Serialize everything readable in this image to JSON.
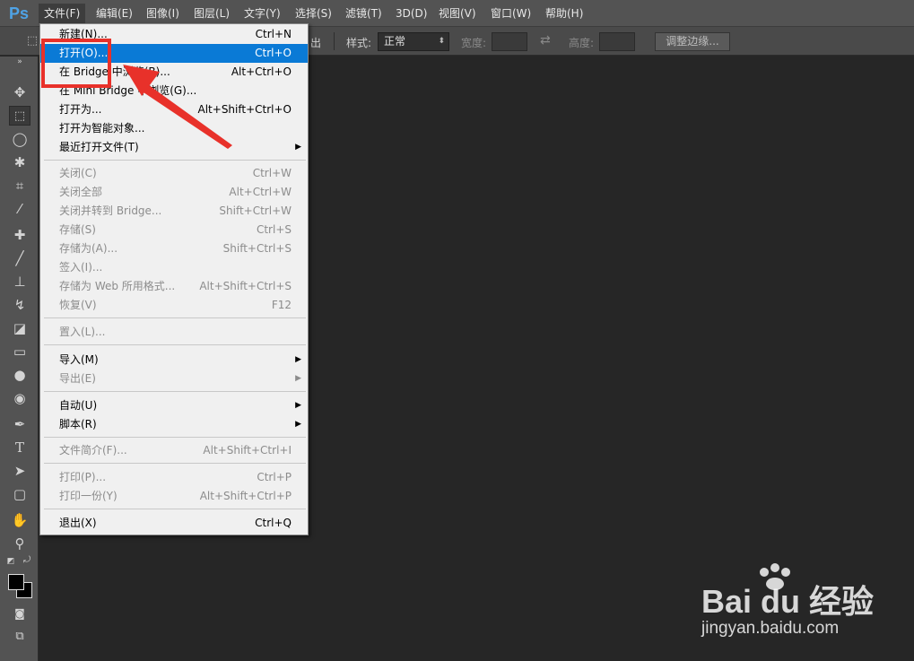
{
  "app": {
    "logo": "Ps"
  },
  "menubar": {
    "items": [
      "文件(F)",
      "编辑(E)",
      "图像(I)",
      "图层(L)",
      "文字(Y)",
      "选择(S)",
      "滤镜(T)",
      "3D(D)",
      "视图(V)",
      "窗口(W)",
      "帮助(H)"
    ]
  },
  "options": {
    "partial_label": "出",
    "style_label": "样式:",
    "style_value": "正常",
    "width_label": "宽度:",
    "height_label": "高度:",
    "refine_button": "调整边缘..."
  },
  "file_menu": {
    "items": [
      {
        "label": "新建(N)...",
        "shortcut": "Ctrl+N",
        "disabled": false
      },
      {
        "label": "打开(O)...",
        "shortcut": "Ctrl+O",
        "disabled": false,
        "highlighted": true
      },
      {
        "label": "在 Bridge 中浏览(B)...",
        "shortcut": "Alt+Ctrl+O",
        "disabled": false
      },
      {
        "label": "在 Mini Bridge 中浏览(G)...",
        "shortcut": "",
        "disabled": false
      },
      {
        "label": "打开为...",
        "shortcut": "Alt+Shift+Ctrl+O",
        "disabled": false
      },
      {
        "label": "打开为智能对象...",
        "shortcut": "",
        "disabled": false
      },
      {
        "label": "最近打开文件(T)",
        "shortcut": "",
        "disabled": false,
        "submenu": true
      },
      {
        "label": "关闭(C)",
        "shortcut": "Ctrl+W",
        "disabled": true
      },
      {
        "label": "关闭全部",
        "shortcut": "Alt+Ctrl+W",
        "disabled": true
      },
      {
        "label": "关闭并转到 Bridge...",
        "shortcut": "Shift+Ctrl+W",
        "disabled": true
      },
      {
        "label": "存储(S)",
        "shortcut": "Ctrl+S",
        "disabled": true
      },
      {
        "label": "存储为(A)...",
        "shortcut": "Shift+Ctrl+S",
        "disabled": true
      },
      {
        "label": "签入(I)...",
        "shortcut": "",
        "disabled": true
      },
      {
        "label": "存储为 Web 所用格式...",
        "shortcut": "Alt+Shift+Ctrl+S",
        "disabled": true
      },
      {
        "label": "恢复(V)",
        "shortcut": "F12",
        "disabled": true
      },
      {
        "label": "置入(L)...",
        "shortcut": "",
        "disabled": true
      },
      {
        "label": "导入(M)",
        "shortcut": "",
        "disabled": false,
        "submenu": true
      },
      {
        "label": "导出(E)",
        "shortcut": "",
        "disabled": true,
        "submenu": true
      },
      {
        "label": "自动(U)",
        "shortcut": "",
        "disabled": false,
        "submenu": true
      },
      {
        "label": "脚本(R)",
        "shortcut": "",
        "disabled": false,
        "submenu": true
      },
      {
        "label": "文件简介(F)...",
        "shortcut": "Alt+Shift+Ctrl+I",
        "disabled": true
      },
      {
        "label": "打印(P)...",
        "shortcut": "Ctrl+P",
        "disabled": true
      },
      {
        "label": "打印一份(Y)",
        "shortcut": "Alt+Shift+Ctrl+P",
        "disabled": true
      },
      {
        "label": "退出(X)",
        "shortcut": "Ctrl+Q",
        "disabled": false
      }
    ]
  },
  "watermark": {
    "brand": "Bai du 经验",
    "url": "jingyan.baidu.com"
  },
  "colors": {
    "highlight": "#0a7ad6",
    "annotation": "#e8312a"
  }
}
